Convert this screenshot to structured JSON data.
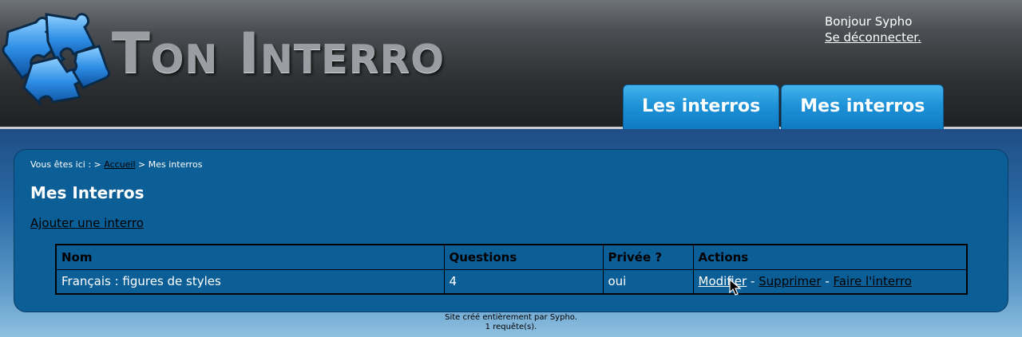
{
  "header": {
    "logo_text": "Ton Interro",
    "greeting": "Bonjour Sypho",
    "logout_label": "Se déconnecter.",
    "nav": [
      {
        "label": "Les interros"
      },
      {
        "label": "Mes interros"
      }
    ]
  },
  "breadcrumb": {
    "prefix": "Vous êtes ici : >",
    "home": "Accueil",
    "current": "> Mes interros"
  },
  "main": {
    "title": "Mes Interros",
    "add_label": "Ajouter une interro",
    "table": {
      "columns": [
        "Nom",
        "Questions",
        "Privée ?",
        "Actions"
      ],
      "rows": [
        {
          "name": "Français : figures de styles",
          "questions": "4",
          "private": "oui",
          "actions": {
            "edit": "Modifier",
            "delete": "Supprimer",
            "take": "Faire l'interro",
            "separator": "-"
          }
        }
      ]
    }
  },
  "footer": {
    "line1": "Site créé entièrement par Sypho.",
    "line2": "1 requête(s)."
  },
  "colors": {
    "tab_blue": "#1e93d8",
    "content_blue": "#0c5e96",
    "header_dark": "#2e3033"
  }
}
